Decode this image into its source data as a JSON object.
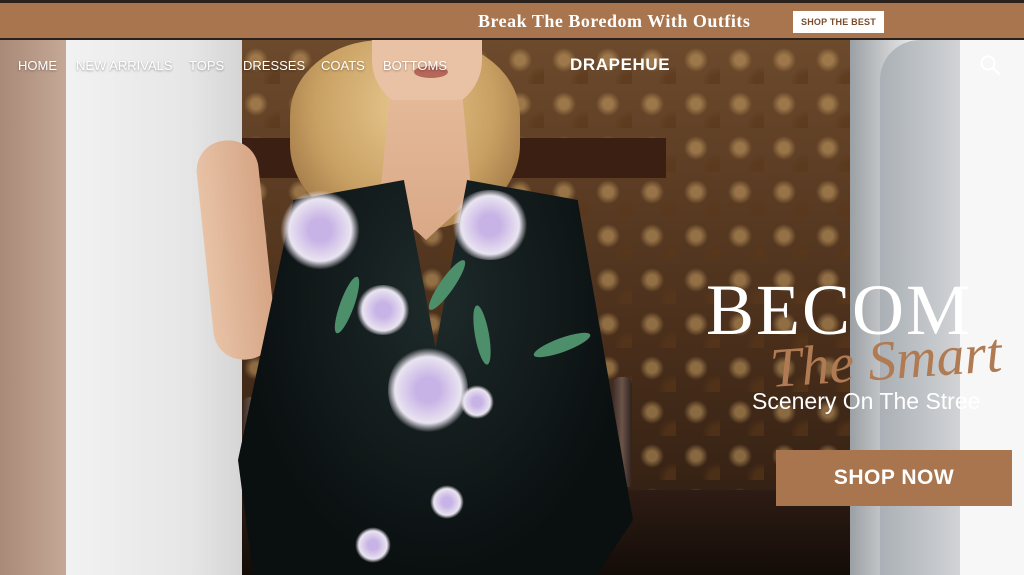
{
  "promo": {
    "text": "Break The Boredom With Outfits",
    "button_label": "SHOP THE BEST"
  },
  "nav": {
    "links": [
      "HOME",
      "NEW ARRIVALS",
      "TOPS",
      "DRESSES",
      "COATS",
      "BOTTOMS"
    ],
    "logo": "DRAPEHUE",
    "search_icon": "search-icon"
  },
  "hero": {
    "headline": "BECOM",
    "script_text": "The Smart",
    "subline": "Scenery On The Stree",
    "cta_label": "SHOP NOW"
  },
  "colors": {
    "accent": "#a8754e",
    "text_light": "#ffffff"
  }
}
